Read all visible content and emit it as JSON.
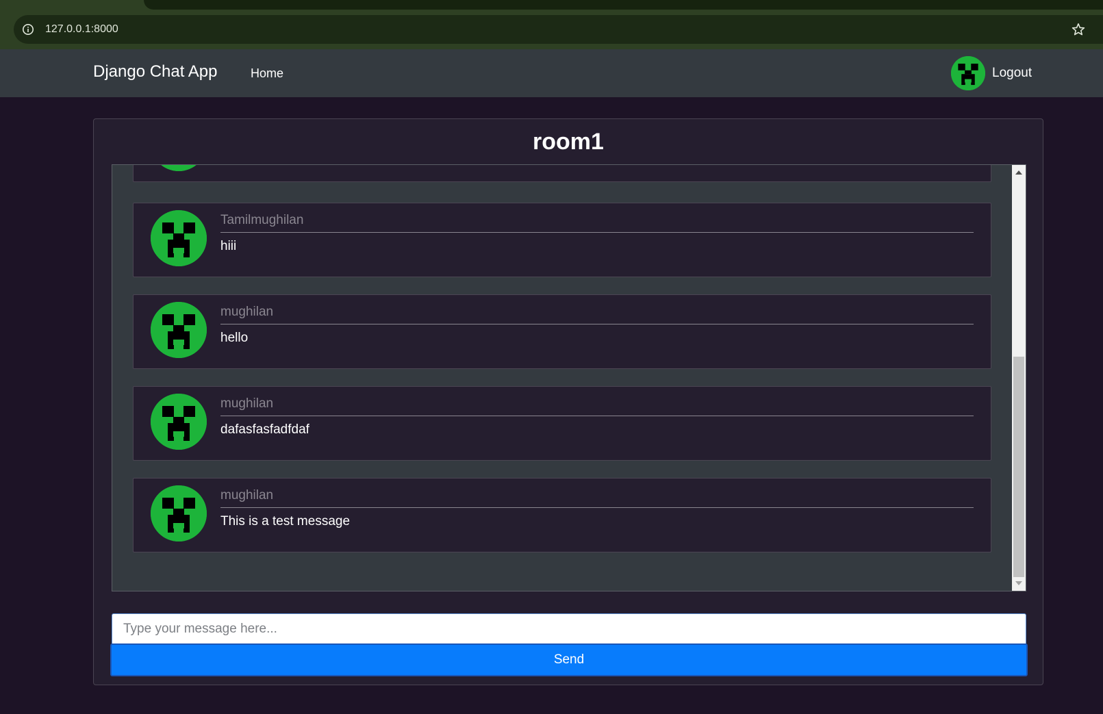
{
  "browser": {
    "url": "127.0.0.1:8000"
  },
  "navbar": {
    "brand": "Django Chat App",
    "home_label": "Home",
    "logout_label": "Logout"
  },
  "room": {
    "title": "room1"
  },
  "messages": [
    {
      "user": "",
      "text": ""
    },
    {
      "user": "Tamilmughilan",
      "text": "hiii"
    },
    {
      "user": "mughilan",
      "text": "hello"
    },
    {
      "user": "mughilan",
      "text": "dafasfasfadfdaf"
    },
    {
      "user": "mughilan",
      "text": "This is a test message"
    }
  ],
  "composer": {
    "placeholder": "Type your message here...",
    "send_label": "Send"
  },
  "colors": {
    "avatar_green": "#1db43a",
    "send_blue": "#087cfc",
    "navbar": "#343a40",
    "page_bg": "#1d1326"
  },
  "icons": {
    "avatar": "creeper-avatar-icon",
    "info": "info-icon",
    "bookmark": "star-icon"
  }
}
